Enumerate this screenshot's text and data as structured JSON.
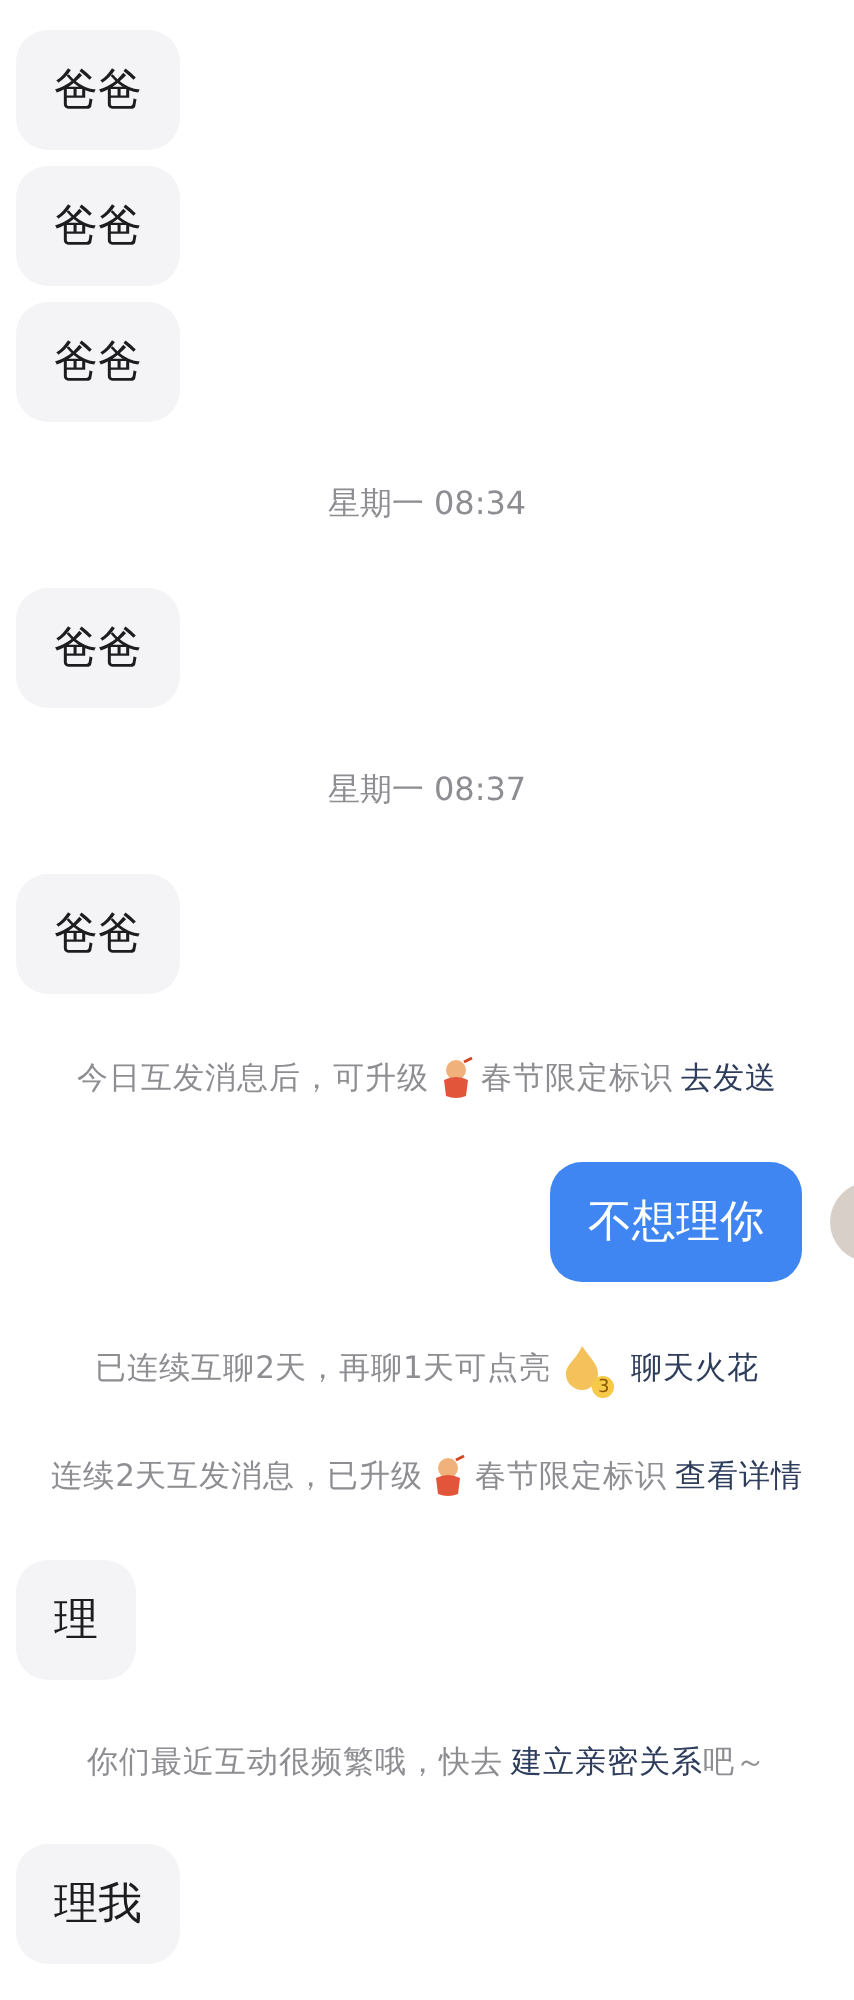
{
  "messages": [
    {
      "kind": "incoming",
      "text": "爸爸"
    },
    {
      "kind": "incoming",
      "text": "爸爸"
    },
    {
      "kind": "incoming",
      "text": "爸爸"
    },
    {
      "kind": "time",
      "text": "星期一 08:34"
    },
    {
      "kind": "incoming",
      "text": "爸爸"
    },
    {
      "kind": "time",
      "text": "星期一 08:37"
    },
    {
      "kind": "incoming",
      "text": "爸爸"
    },
    {
      "kind": "notice",
      "parts": [
        {
          "kind": "text",
          "text": "今日互发消息后，可升级"
        },
        {
          "kind": "mascot"
        },
        {
          "kind": "text",
          "text": "春节限定标识"
        },
        {
          "kind": "link",
          "text": "去发送"
        }
      ]
    },
    {
      "kind": "outgoing",
      "text": "不想理你"
    },
    {
      "kind": "notice",
      "parts": [
        {
          "kind": "text",
          "text": "已连续互聊2天，再聊1天可点亮"
        },
        {
          "kind": "flame",
          "badge": "3"
        },
        {
          "kind": "link",
          "text": "聊天火花"
        }
      ]
    },
    {
      "kind": "notice",
      "parts": [
        {
          "kind": "text",
          "text": "连续2天互发消息，已升级"
        },
        {
          "kind": "mascot"
        },
        {
          "kind": "text",
          "text": "春节限定标识"
        },
        {
          "kind": "link",
          "text": "查看详情"
        }
      ]
    },
    {
      "kind": "incoming",
      "text": "理"
    },
    {
      "kind": "notice",
      "parts": [
        {
          "kind": "text",
          "text": "你们最近互动很频繁哦，快去"
        },
        {
          "kind": "link",
          "text": "建立亲密关系"
        },
        {
          "kind": "text",
          "text": "吧～"
        }
      ]
    },
    {
      "kind": "incoming",
      "text": "理我"
    }
  ]
}
